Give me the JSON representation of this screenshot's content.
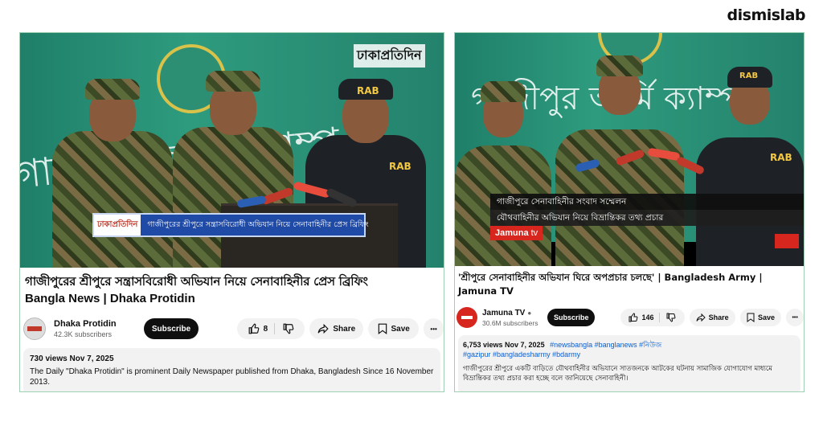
{
  "brand": "dismislab",
  "left": {
    "overlay_logo": "ঢাকাপ্রতিদিন",
    "lower_third_logo": "ঢাকাপ্রতিদিন",
    "lower_third_text": "গাজীপুরের শ্রীপুরে সন্ত্রাসবিরোধী অভিযান নিয়ে সেনাবাহিনীর প্রেস ব্রিফিং",
    "rab_label": "RAB",
    "title_line1": "গাজীপুরের শ্রীপুরে সন্ত্রাসবিরোধী অভিযান নিয়ে সেনাবাহিনীর প্রেস ব্রিফিং",
    "title_line2": "Bangla News | Dhaka Protidin",
    "channel_name": "Dhaka Protidin",
    "subscribers": "42.3K subscribers",
    "subscribe_label": "Subscribe",
    "likes": "8",
    "share_label": "Share",
    "save_label": "Save",
    "more_label": "•••",
    "views_date": "730 views  Nov 7, 2025",
    "description": "The Daily \"Dhaka Protidin\" is prominent Daily Newspaper published from Dhaka, Bangladesh Since 16 November 2013."
  },
  "right": {
    "lower_third_line1": "গাজীপুরে সেনাবাহিনীর সংবাদ সম্মেলন",
    "lower_third_line2": "যৌথবাহিনীর অভিযান নিয়ে বিভ্রান্তিকর তথ্য প্রচার",
    "tv_logo": "Jamuna",
    "tv_logo_suffix": "tv",
    "rab_label": "RAB",
    "title": "'শ্রীপুরে সেনাবাহিনীর অভিযান ঘিরে অপপ্রচার চলছে' | Bangladesh Army | Jamuna TV",
    "channel_name": "Jamuna TV",
    "verified": "●",
    "subscribers": "30.6M subscribers",
    "subscribe_label": "Subscribe",
    "likes": "146",
    "share_label": "Share",
    "save_label": "Save",
    "more_label": "•••",
    "views_date": "6,753 views  Nov 7, 2025",
    "tags_line1": "#newsbangla #banglanews #নিউজ",
    "tags_line2": "#gazipur #bangladesharmy #bdarmy",
    "description": "গাজীপুরের শ্রীপুরে একটি বাড়িতে যৌথবাহিনীর অভিযানে সাতজনকে আটকের ঘটনায় সামাজিক যোগাযোগ মাধ্যমে বিভ্রান্তিকর তথ্য প্রচার করা হচ্ছে বলে জানিয়েছে সেনাবাহিনী।"
  },
  "colors": {
    "bg_green": "#1f7f69",
    "border": "#9fd0b4",
    "jamuna_red": "#d7261e",
    "link_blue": "#065fd4"
  },
  "icons": [
    "like-icon",
    "dislike-icon",
    "share-icon",
    "save-icon",
    "more-icon",
    "verified-icon"
  ]
}
